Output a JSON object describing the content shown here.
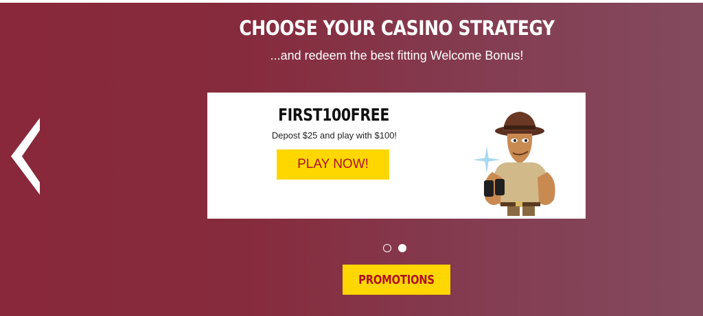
{
  "header": {
    "title": "CHOOSE YOUR CASINO STRATEGY",
    "subtitle": "...and redeem the best fitting Welcome Bonus!"
  },
  "carousel": {
    "prev_icon": "chevron-left-icon",
    "slide": {
      "code": "FIRST100FREE",
      "description": "Depost $25 and play with $100!",
      "cta_label": "PLAY NOW!",
      "image": "explorer-mascot-with-binoculars"
    },
    "dots": {
      "count": 2,
      "active_index": 1
    }
  },
  "footer": {
    "promotions_label": "PROMOTIONS"
  },
  "colors": {
    "background_start": "#88283a",
    "background_end": "#834a5e",
    "button_yellow": "#ffd700",
    "button_text": "#b01020",
    "card_bg": "#ffffff"
  }
}
